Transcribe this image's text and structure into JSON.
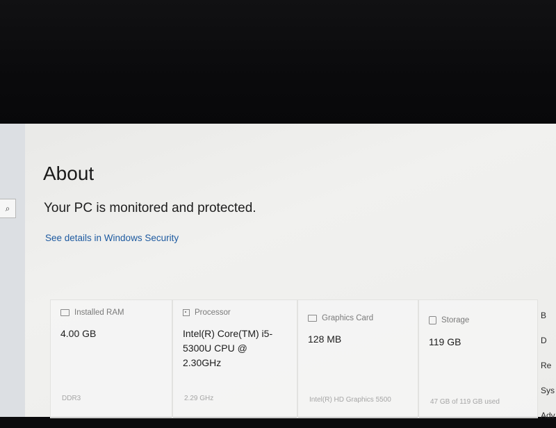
{
  "nav": {
    "search_icon": "search-icon"
  },
  "page": {
    "title": "About",
    "status": "Your PC is monitored and protected.",
    "security_link": "See details in Windows Security"
  },
  "specs": [
    {
      "label": "Installed RAM",
      "value": "4.00 GB",
      "sub": "DDR3",
      "icon": "ram-icon"
    },
    {
      "label": "Processor",
      "value": "Intel(R) Core(TM) i5-5300U CPU @ 2.30GHz",
      "sub": "2.29 GHz",
      "icon": "processor-icon"
    },
    {
      "label": "Graphics Card",
      "value": "128 MB",
      "sub": "Intel(R) HD Graphics 5500",
      "icon": "graphics-card-icon"
    },
    {
      "label": "Storage",
      "value": "119 GB",
      "sub": "47 GB of 119 GB used",
      "icon": "storage-icon"
    }
  ],
  "right_links": [
    "B",
    "D",
    "Re",
    "Sys",
    "Adv"
  ]
}
